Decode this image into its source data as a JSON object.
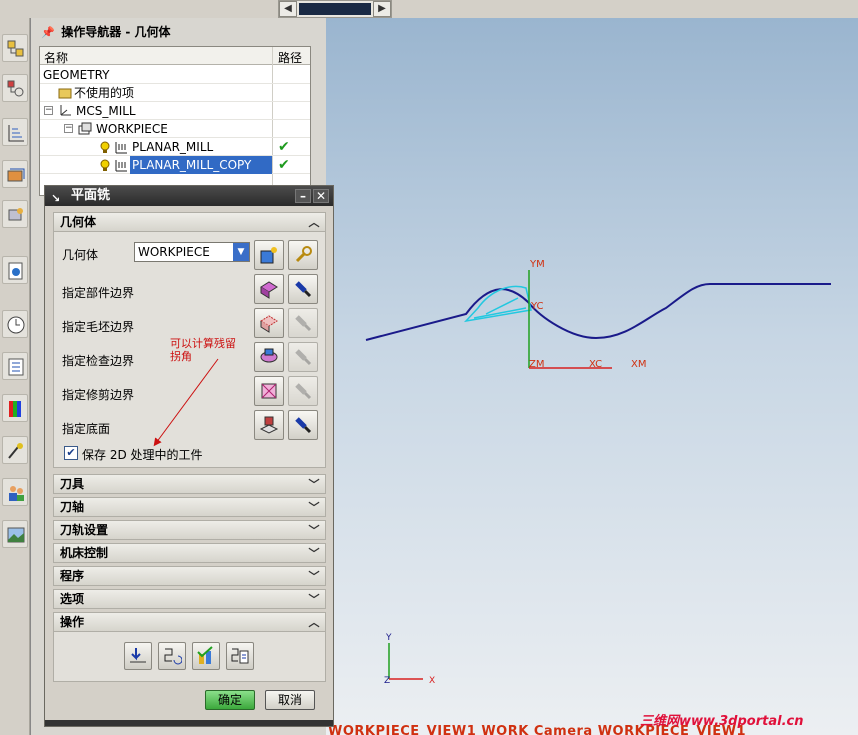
{
  "navigator": {
    "title": "操作导航器 - 几何体",
    "columns": [
      "名称",
      "路径"
    ],
    "rows": [
      {
        "label": "GEOMETRY"
      },
      {
        "label": "不使用的项"
      },
      {
        "label": "MCS_MILL"
      },
      {
        "label": "WORKPIECE"
      },
      {
        "label": "PLANAR_MILL",
        "path": "✔"
      },
      {
        "label": "PLANAR_MILL_COPY",
        "path": "✔"
      }
    ]
  },
  "dialog": {
    "title": "平面铣",
    "geometry_section": "几何体",
    "geometry_label": "几何体",
    "geometry_value": "WORKPIECE",
    "fields": [
      "指定部件边界",
      "指定毛坯边界",
      "指定检查边界",
      "指定修剪边界",
      "指定底面"
    ],
    "keep_checkbox": "保存 2D 处理中的工件",
    "sections": [
      "刀具",
      "刀轴",
      "刀轨设置",
      "机床控制",
      "程序",
      "选项",
      "操作"
    ],
    "ok": "确定",
    "cancel": "取消"
  },
  "annotation": {
    "line1": "可以计算残留",
    "line2": "拐角"
  },
  "graphics": {
    "labels": {
      "ym": "YM",
      "yc": "YC",
      "zm": "ZM",
      "xc": "XC",
      "xm": "XM",
      "y": "Y",
      "z": "Z",
      "x": "X"
    },
    "status": "WORKPIECE_VIEW1 WORK Camera WORKPIECE_VIEW1",
    "watermark": "三维网www.3dportal.cn",
    "colors": {
      "curve": "#1a1a8a",
      "tool": "#22c8e0",
      "axis_y": "#20a020",
      "axis_x": "#d82020"
    }
  }
}
